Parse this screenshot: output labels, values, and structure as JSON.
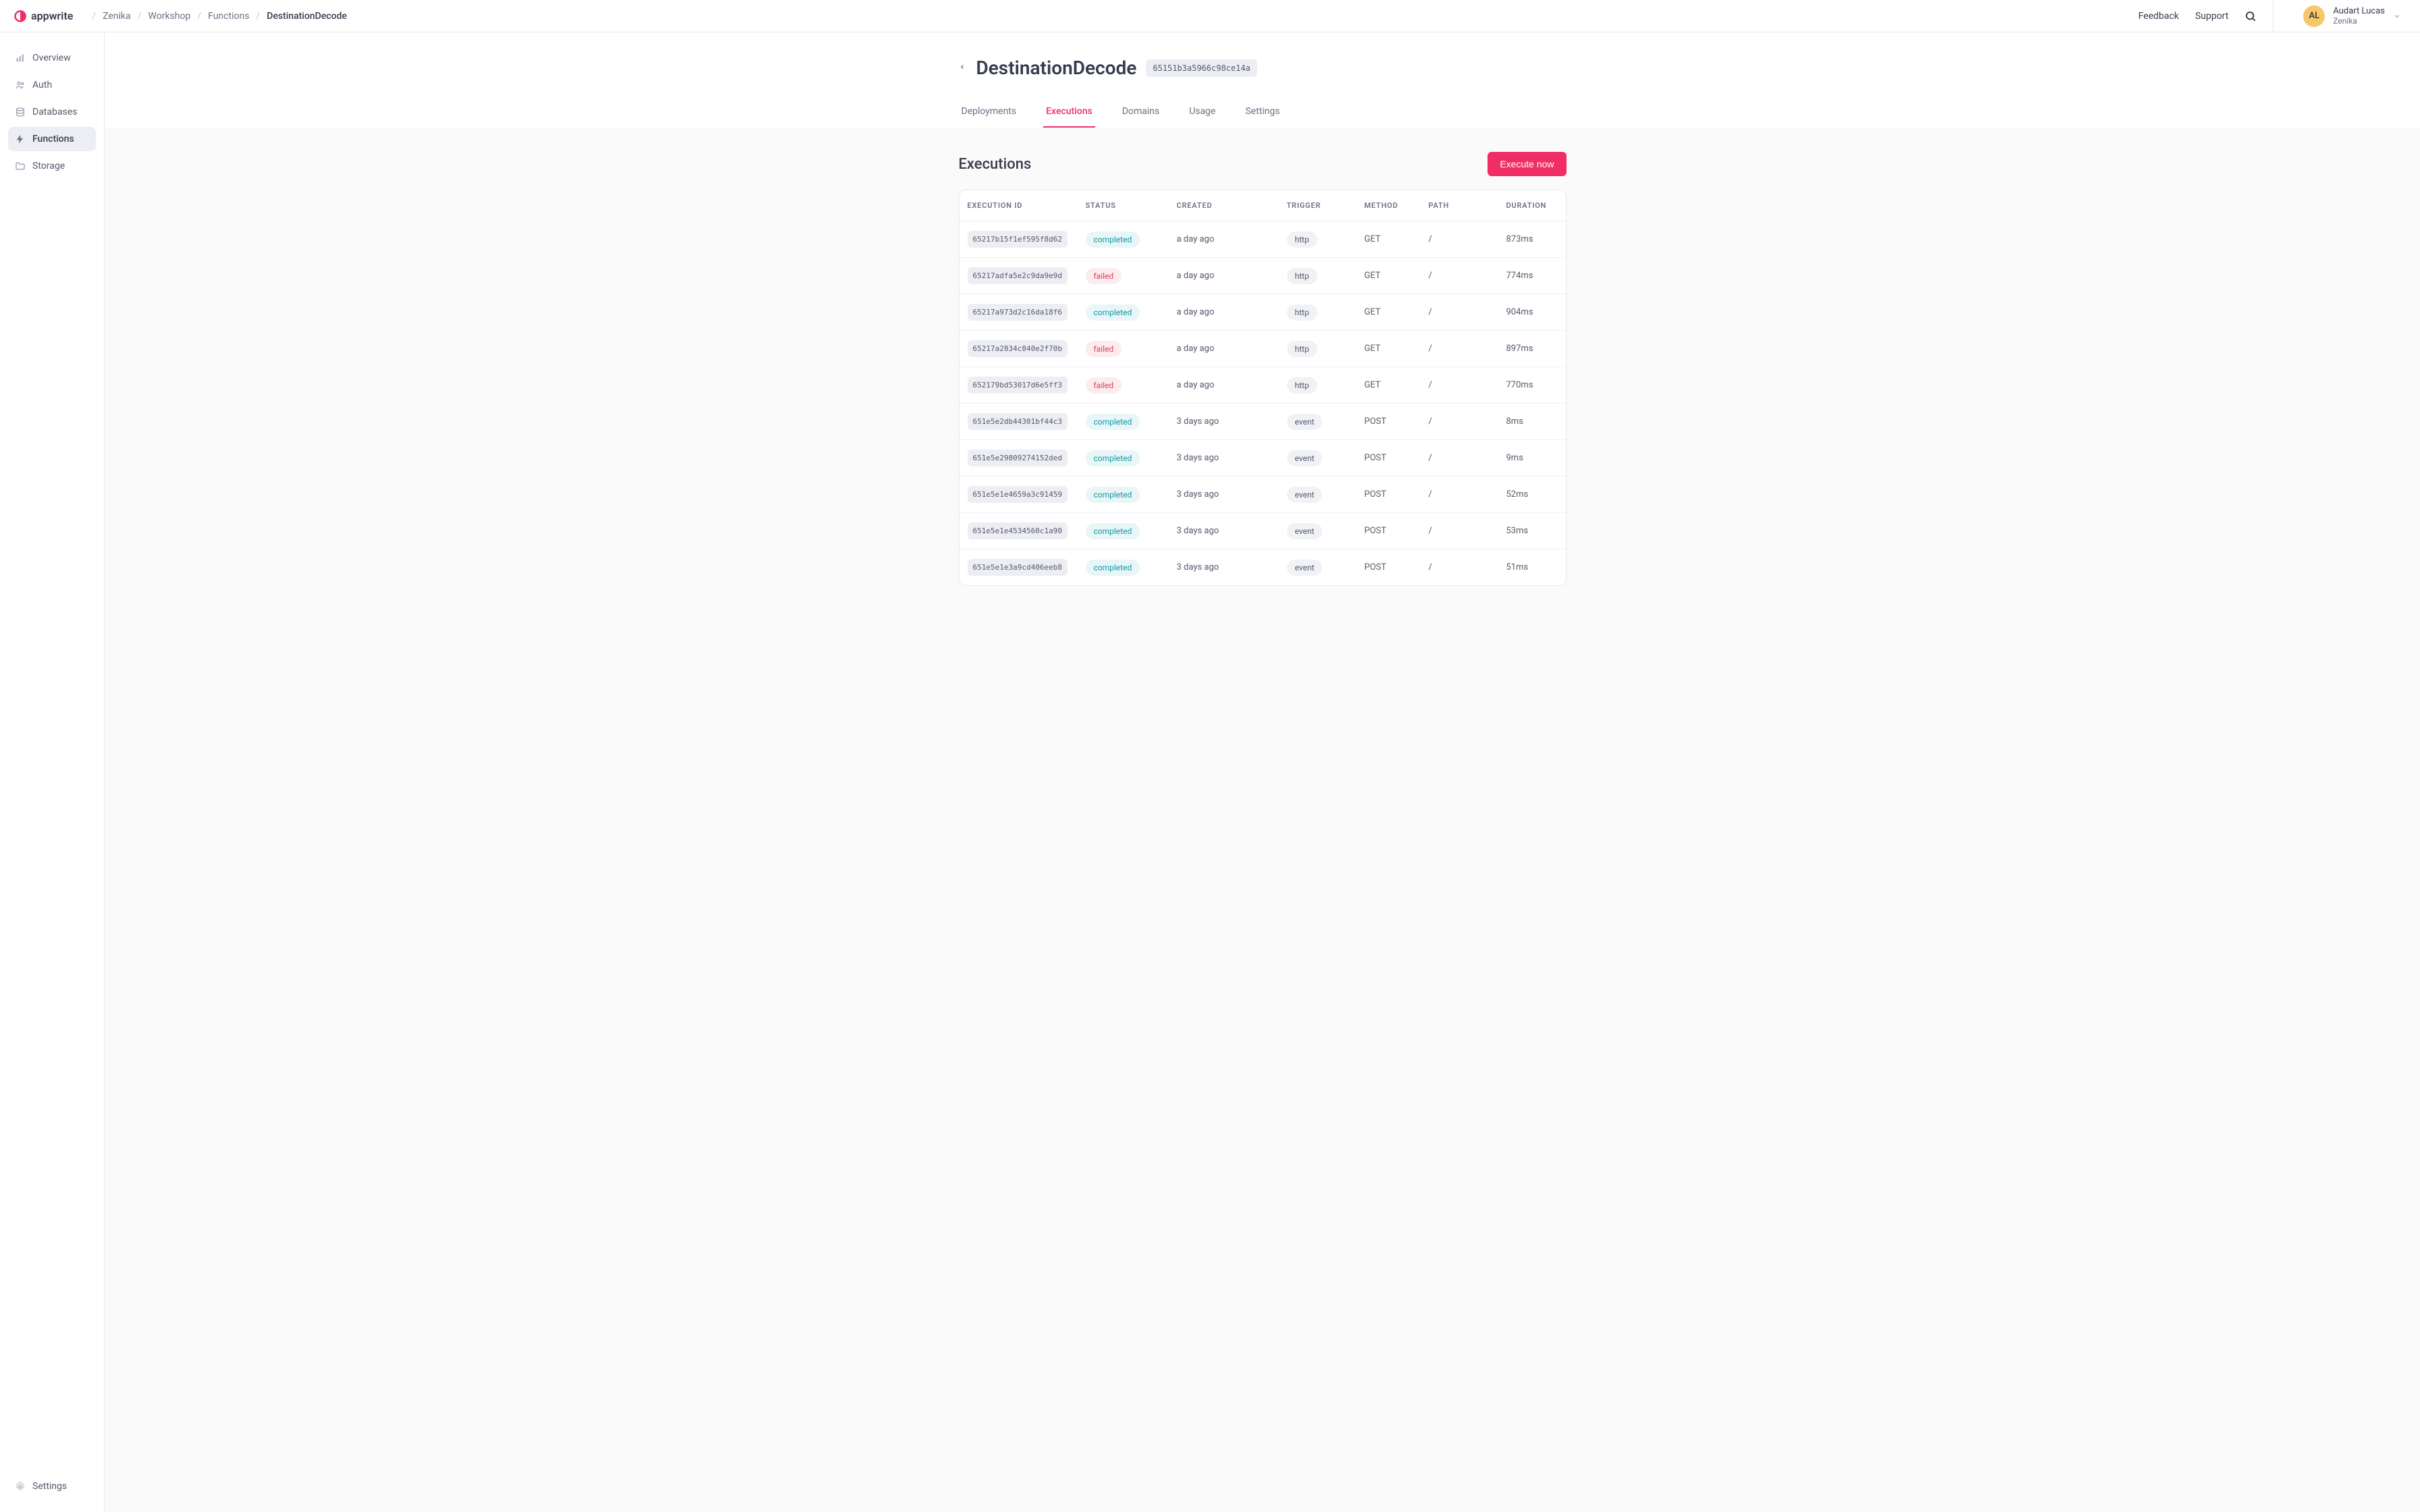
{
  "brand": "appwrite",
  "breadcrumb": [
    "Zenika",
    "Workshop",
    "Functions",
    "DestinationDecode"
  ],
  "topbar": {
    "feedback": "Feedback",
    "support": "Support"
  },
  "user": {
    "initials": "AL",
    "name": "Audart Lucas",
    "org": "Zenika"
  },
  "sidebar": {
    "items": [
      {
        "label": "Overview",
        "icon": "bars-icon"
      },
      {
        "label": "Auth",
        "icon": "users-icon"
      },
      {
        "label": "Databases",
        "icon": "database-icon"
      },
      {
        "label": "Functions",
        "icon": "bolt-icon",
        "active": true
      },
      {
        "label": "Storage",
        "icon": "folder-icon"
      }
    ],
    "settings": "Settings"
  },
  "page": {
    "title": "DestinationDecode",
    "functionId": "65151b3a5966c98ce14a"
  },
  "tabs": [
    "Deployments",
    "Executions",
    "Domains",
    "Usage",
    "Settings"
  ],
  "activeTab": 1,
  "section": {
    "title": "Executions",
    "executeBtn": "Execute now"
  },
  "table": {
    "columns": [
      "EXECUTION ID",
      "STATUS",
      "CREATED",
      "TRIGGER",
      "METHOD",
      "PATH",
      "DURATION"
    ],
    "rows": [
      {
        "id": "65217b15f1ef595f8d62",
        "status": "completed",
        "created": "a day ago",
        "trigger": "http",
        "method": "GET",
        "path": "/",
        "duration": "873ms"
      },
      {
        "id": "65217adfa5e2c9da9e9d",
        "status": "failed",
        "created": "a day ago",
        "trigger": "http",
        "method": "GET",
        "path": "/",
        "duration": "774ms"
      },
      {
        "id": "65217a973d2c16da18f6",
        "status": "completed",
        "created": "a day ago",
        "trigger": "http",
        "method": "GET",
        "path": "/",
        "duration": "904ms"
      },
      {
        "id": "65217a2834c840e2f70b",
        "status": "failed",
        "created": "a day ago",
        "trigger": "http",
        "method": "GET",
        "path": "/",
        "duration": "897ms"
      },
      {
        "id": "652179bd53017d6e5ff3",
        "status": "failed",
        "created": "a day ago",
        "trigger": "http",
        "method": "GET",
        "path": "/",
        "duration": "770ms"
      },
      {
        "id": "651e5e2db44301bf44c3",
        "status": "completed",
        "created": "3 days ago",
        "trigger": "event",
        "method": "POST",
        "path": "/",
        "duration": "8ms"
      },
      {
        "id": "651e5e29809274152ded",
        "status": "completed",
        "created": "3 days ago",
        "trigger": "event",
        "method": "POST",
        "path": "/",
        "duration": "9ms"
      },
      {
        "id": "651e5e1e4659a3c91459",
        "status": "completed",
        "created": "3 days ago",
        "trigger": "event",
        "method": "POST",
        "path": "/",
        "duration": "52ms"
      },
      {
        "id": "651e5e1e4534560c1a90",
        "status": "completed",
        "created": "3 days ago",
        "trigger": "event",
        "method": "POST",
        "path": "/",
        "duration": "53ms"
      },
      {
        "id": "651e5e1e3a9cd406eeb8",
        "status": "completed",
        "created": "3 days ago",
        "trigger": "event",
        "method": "POST",
        "path": "/",
        "duration": "51ms"
      }
    ]
  }
}
